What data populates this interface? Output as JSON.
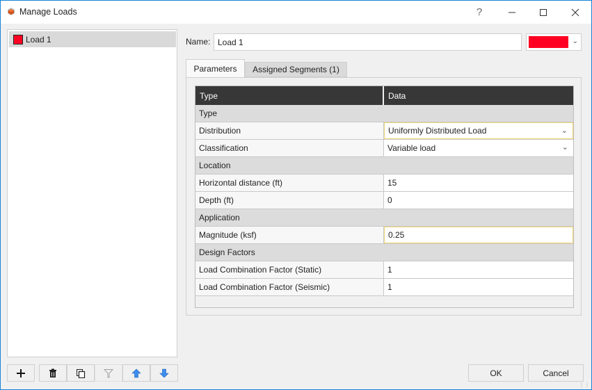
{
  "window": {
    "title": "Manage Loads",
    "help_label": "?",
    "accent_color": "#1883d7"
  },
  "loads_list": {
    "items": [
      {
        "label": "Load 1",
        "color": "#ff0022",
        "selected": true
      }
    ]
  },
  "toolbar": {
    "buttons": [
      {
        "name": "add",
        "icon": "plus-icon",
        "enabled": true
      },
      {
        "name": "delete",
        "icon": "trash-icon",
        "enabled": true
      },
      {
        "name": "copy",
        "icon": "copy-icon",
        "enabled": true
      },
      {
        "name": "filter",
        "icon": "filter-icon",
        "enabled": false
      },
      {
        "name": "move-up",
        "icon": "arrow-up-icon",
        "enabled": true
      },
      {
        "name": "move-down",
        "icon": "arrow-down-icon",
        "enabled": true
      }
    ]
  },
  "name_field": {
    "label": "Name:",
    "value": "Load 1",
    "color": "#ff0022"
  },
  "tabs": [
    {
      "label": "Parameters",
      "active": true
    },
    {
      "label": "Assigned Segments (1)",
      "active": false
    }
  ],
  "grid": {
    "headers": [
      "Type",
      "Data"
    ],
    "rows": [
      {
        "kind": "section",
        "label": "Type"
      },
      {
        "kind": "row",
        "label": "Distribution",
        "value": "Uniformly Distributed Load",
        "dropdown": true,
        "focused": true
      },
      {
        "kind": "row",
        "label": "Classification",
        "value": "Variable load",
        "dropdown": true,
        "focused": false
      },
      {
        "kind": "section",
        "label": "Location"
      },
      {
        "kind": "row",
        "label": "Horizontal distance (ft)",
        "value": "15"
      },
      {
        "kind": "row",
        "label": "Depth (ft)",
        "value": "0"
      },
      {
        "kind": "section",
        "label": "Application"
      },
      {
        "kind": "row",
        "label": "Magnitude (ksf)",
        "value": "0.25",
        "focused": true
      },
      {
        "kind": "section",
        "label": "Design Factors"
      },
      {
        "kind": "row",
        "label": "Load Combination Factor (Static)",
        "value": "1"
      },
      {
        "kind": "row",
        "label": "Load Combination Factor (Seismic)",
        "value": "1"
      }
    ]
  },
  "footer": {
    "ok_label": "OK",
    "cancel_label": "Cancel"
  }
}
